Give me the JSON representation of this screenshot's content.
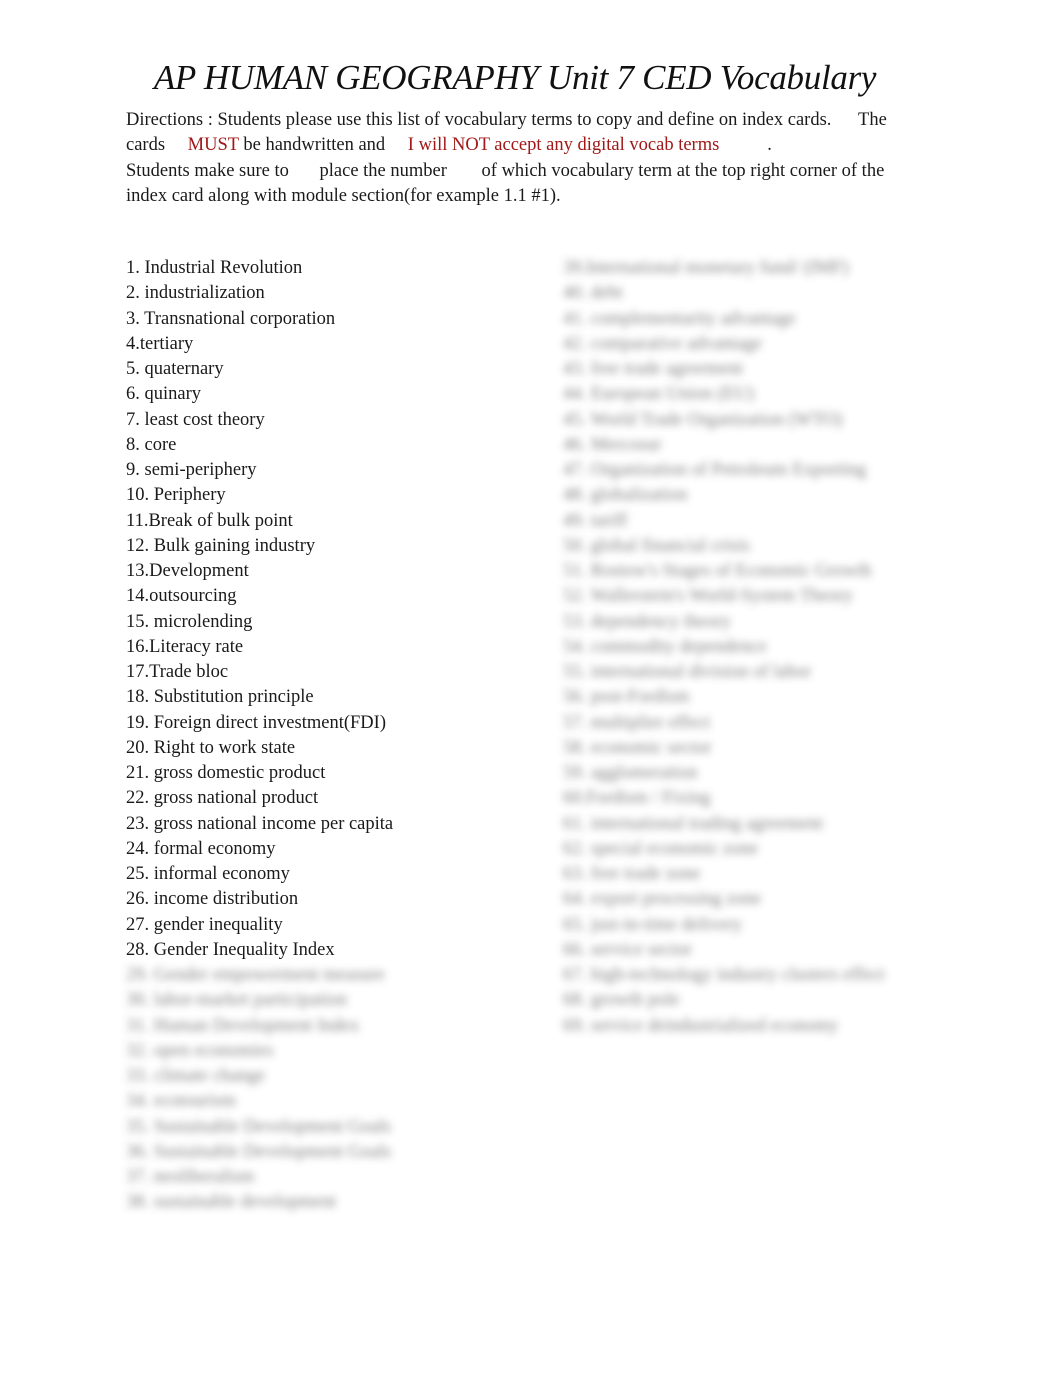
{
  "document": {
    "title": "AP HUMAN GEOGRAPHY Unit 7 CED Vocabulary",
    "directions": {
      "part1": "Directions",
      "part2": ":  Students please use this list of vocabulary terms to copy and define on index cards.",
      "part3": "The cards",
      "must": "MUST",
      "part4": "be handwritten and",
      "warning": "I will NOT accept any digital vocab terms",
      "part5": ".",
      "part6": "Students make sure to",
      "part7": "place the number",
      "part8": "of which vocabulary term at the top right corner of the index card along with module section(for example 1.1 #1)."
    },
    "colors": {
      "emphasis": "#a01818",
      "text": "#1a1a1a"
    },
    "left_column_visible": [
      "1. Industrial Revolution",
      "2. industrialization",
      "3. Transnational corporation",
      "4.tertiary",
      "5. quaternary",
      "6. quinary",
      "7. least cost theory",
      "8. core",
      "9. semi-periphery",
      "10. Periphery",
      "11.Break of bulk point",
      "12. Bulk gaining industry",
      "13.Development",
      "14.outsourcing",
      "15. microlending",
      "16.Literacy rate",
      "17.Trade bloc",
      "18. Substitution principle",
      "19. Foreign direct investment(FDI)",
      "20.   Right to work state",
      "21. gross domestic product",
      "22. gross national product",
      "23. gross national income per capita",
      "24. formal economy",
      "25. informal economy",
      "26. income distribution",
      "27. gender inequality",
      "28. Gender Inequality Index"
    ],
    "left_column_blurred": [
      "29. Gender empowerment measure",
      "30. labor-market participation",
      "31. Human Development Index",
      "32. open economies",
      "33. climate change",
      "34. ecotourism",
      "35. Sustainable Development Goals",
      "36. Sustainable Development Goals",
      "37. neoliberalism",
      "38. sustainable development"
    ],
    "right_column_blurred": [
      "39.International monetary fund/ (IMF)",
      "40. debt",
      "41. complementarity advantage",
      "42. comparative advantage",
      "43. free trade agreement",
      "44. European Union (EU)",
      "45. World Trade Organization (WTO)",
      "46. Mercosur",
      "47. Organization of Petroleum Exporting",
      "48. globalization",
      "49. tariff",
      "50. global financial crisis",
      "51. Rostow's Stages of Economic Growth",
      "52. Wallerstein's World-System Theory",
      "53. dependency theory",
      "54. commodity dependence",
      "55. international division of labor",
      "56. post-Fordism",
      "57. multiplier effect",
      "58. economic sector",
      "59. agglomeration",
      "60.Fordism / Fixing",
      "61. international trading agreement",
      "62. special economic zone",
      "63. free trade zone",
      "64. export processing zone",
      "65. just-in-time delivery",
      "66. service sector",
      "67. high-technology industry clusters effect",
      "68. growth pole",
      "69. service deindustrialized economy"
    ]
  }
}
